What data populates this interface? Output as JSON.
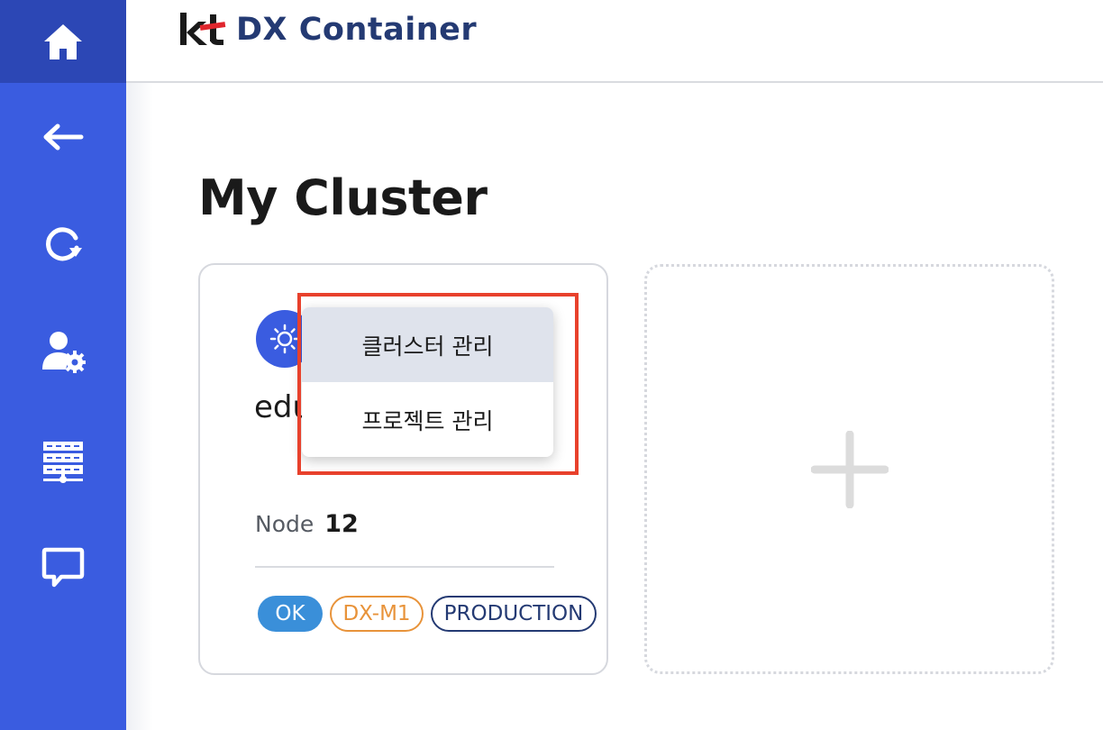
{
  "header": {
    "logo_mark": "kt",
    "app_title": "DX Container"
  },
  "sidebar": {
    "items": [
      {
        "icon": "home-icon",
        "active": true
      },
      {
        "icon": "back-arrow-icon"
      },
      {
        "icon": "refresh-icon"
      },
      {
        "icon": "user-settings-icon"
      },
      {
        "icon": "server-icon"
      },
      {
        "icon": "chat-icon"
      }
    ]
  },
  "main": {
    "title": "My Cluster",
    "cluster_card": {
      "name": "edu",
      "node_label": "Node",
      "node_count": "12",
      "tags": [
        "OK",
        "DX-M1",
        "PRODUCTION"
      ]
    },
    "add_card": {
      "icon": "plus-icon"
    }
  },
  "context_menu": {
    "items": [
      "클러스터 관리",
      "프로젝트 관리"
    ],
    "hovered_index": 0
  },
  "colors": {
    "sidebar": "#3a5ce0",
    "sidebar_active": "#2c47b5",
    "brand_text": "#243a73",
    "logo_red": "#e0262d",
    "tag_ok": "#3a8fd9",
    "tag_env": "#e8933a",
    "highlight": "#e8412c"
  }
}
